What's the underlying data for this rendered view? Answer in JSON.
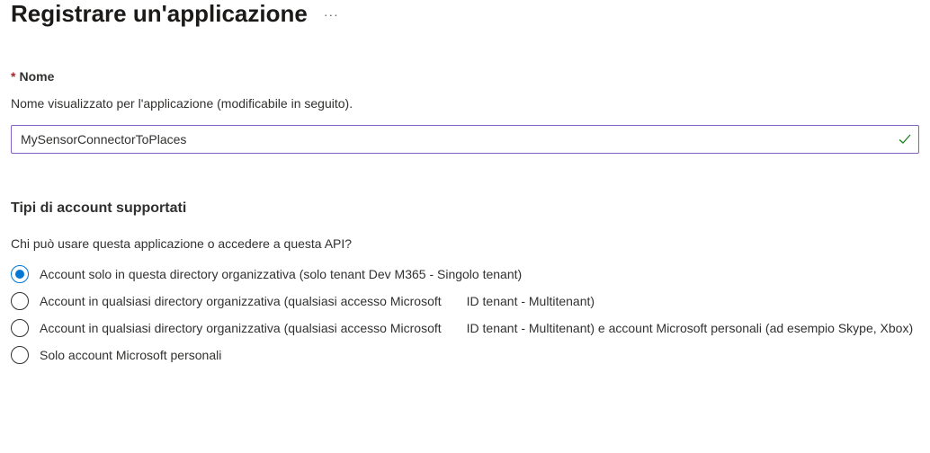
{
  "header": {
    "title": "Registrare un'applicazione"
  },
  "nameField": {
    "label": "Nome",
    "description": "Nome visualizzato per l'applicazione (modificabile in seguito).",
    "value": "MySensorConnectorToPlaces"
  },
  "accountTypes": {
    "title": "Tipi di account supportati",
    "question": "Chi può usare questa applicazione o accedere a questa API?",
    "options": [
      {
        "label": "Account solo in questa directory organizzativa (solo tenant Dev M365 - Singolo tenant)",
        "selected": true
      },
      {
        "labelPart1": "Account in qualsiasi directory organizzativa (qualsiasi accesso Microsoft",
        "labelPart2": "ID tenant - Multitenant)",
        "selected": false
      },
      {
        "labelPart1": "Account in qualsiasi directory organizzativa (qualsiasi accesso Microsoft",
        "labelPart2": "ID tenant - Multitenant) e account Microsoft personali (ad esempio Skype, Xbox)",
        "selected": false
      },
      {
        "label": "Solo account Microsoft personali",
        "selected": false
      }
    ]
  }
}
